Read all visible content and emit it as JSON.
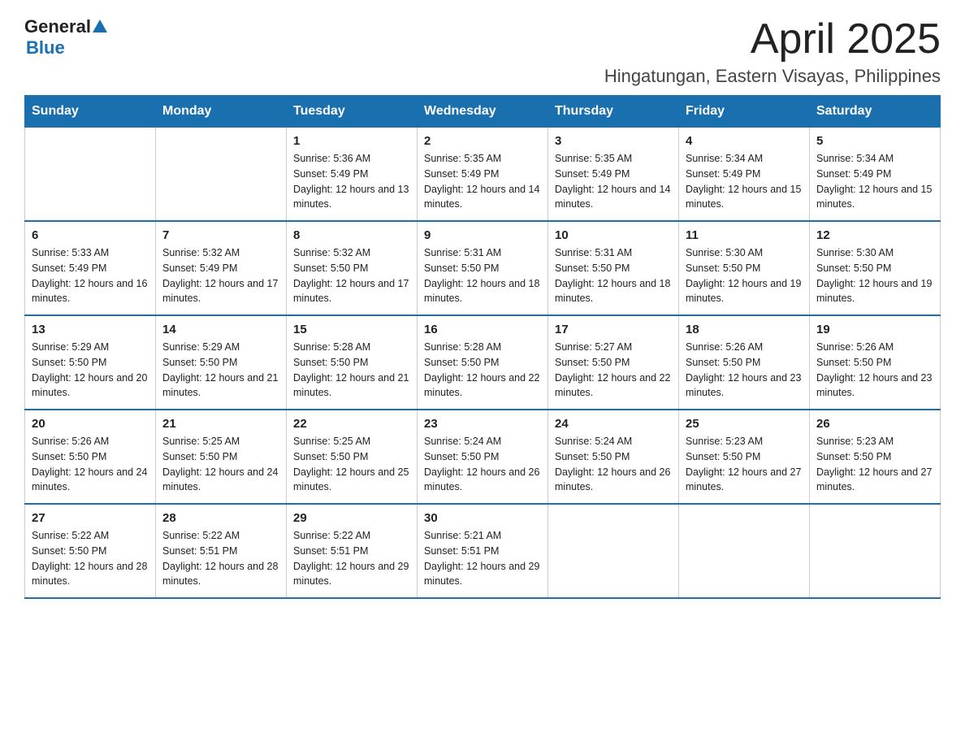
{
  "header": {
    "logo": {
      "general": "General",
      "blue": "Blue"
    },
    "month": "April 2025",
    "location": "Hingatungan, Eastern Visayas, Philippines"
  },
  "days_of_week": [
    "Sunday",
    "Monday",
    "Tuesday",
    "Wednesday",
    "Thursday",
    "Friday",
    "Saturday"
  ],
  "weeks": [
    [
      {
        "day": "",
        "sunrise": "",
        "sunset": "",
        "daylight": ""
      },
      {
        "day": "",
        "sunrise": "",
        "sunset": "",
        "daylight": ""
      },
      {
        "day": "1",
        "sunrise": "Sunrise: 5:36 AM",
        "sunset": "Sunset: 5:49 PM",
        "daylight": "Daylight: 12 hours and 13 minutes."
      },
      {
        "day": "2",
        "sunrise": "Sunrise: 5:35 AM",
        "sunset": "Sunset: 5:49 PM",
        "daylight": "Daylight: 12 hours and 14 minutes."
      },
      {
        "day": "3",
        "sunrise": "Sunrise: 5:35 AM",
        "sunset": "Sunset: 5:49 PM",
        "daylight": "Daylight: 12 hours and 14 minutes."
      },
      {
        "day": "4",
        "sunrise": "Sunrise: 5:34 AM",
        "sunset": "Sunset: 5:49 PM",
        "daylight": "Daylight: 12 hours and 15 minutes."
      },
      {
        "day": "5",
        "sunrise": "Sunrise: 5:34 AM",
        "sunset": "Sunset: 5:49 PM",
        "daylight": "Daylight: 12 hours and 15 minutes."
      }
    ],
    [
      {
        "day": "6",
        "sunrise": "Sunrise: 5:33 AM",
        "sunset": "Sunset: 5:49 PM",
        "daylight": "Daylight: 12 hours and 16 minutes."
      },
      {
        "day": "7",
        "sunrise": "Sunrise: 5:32 AM",
        "sunset": "Sunset: 5:49 PM",
        "daylight": "Daylight: 12 hours and 17 minutes."
      },
      {
        "day": "8",
        "sunrise": "Sunrise: 5:32 AM",
        "sunset": "Sunset: 5:50 PM",
        "daylight": "Daylight: 12 hours and 17 minutes."
      },
      {
        "day": "9",
        "sunrise": "Sunrise: 5:31 AM",
        "sunset": "Sunset: 5:50 PM",
        "daylight": "Daylight: 12 hours and 18 minutes."
      },
      {
        "day": "10",
        "sunrise": "Sunrise: 5:31 AM",
        "sunset": "Sunset: 5:50 PM",
        "daylight": "Daylight: 12 hours and 18 minutes."
      },
      {
        "day": "11",
        "sunrise": "Sunrise: 5:30 AM",
        "sunset": "Sunset: 5:50 PM",
        "daylight": "Daylight: 12 hours and 19 minutes."
      },
      {
        "day": "12",
        "sunrise": "Sunrise: 5:30 AM",
        "sunset": "Sunset: 5:50 PM",
        "daylight": "Daylight: 12 hours and 19 minutes."
      }
    ],
    [
      {
        "day": "13",
        "sunrise": "Sunrise: 5:29 AM",
        "sunset": "Sunset: 5:50 PM",
        "daylight": "Daylight: 12 hours and 20 minutes."
      },
      {
        "day": "14",
        "sunrise": "Sunrise: 5:29 AM",
        "sunset": "Sunset: 5:50 PM",
        "daylight": "Daylight: 12 hours and 21 minutes."
      },
      {
        "day": "15",
        "sunrise": "Sunrise: 5:28 AM",
        "sunset": "Sunset: 5:50 PM",
        "daylight": "Daylight: 12 hours and 21 minutes."
      },
      {
        "day": "16",
        "sunrise": "Sunrise: 5:28 AM",
        "sunset": "Sunset: 5:50 PM",
        "daylight": "Daylight: 12 hours and 22 minutes."
      },
      {
        "day": "17",
        "sunrise": "Sunrise: 5:27 AM",
        "sunset": "Sunset: 5:50 PM",
        "daylight": "Daylight: 12 hours and 22 minutes."
      },
      {
        "day": "18",
        "sunrise": "Sunrise: 5:26 AM",
        "sunset": "Sunset: 5:50 PM",
        "daylight": "Daylight: 12 hours and 23 minutes."
      },
      {
        "day": "19",
        "sunrise": "Sunrise: 5:26 AM",
        "sunset": "Sunset: 5:50 PM",
        "daylight": "Daylight: 12 hours and 23 minutes."
      }
    ],
    [
      {
        "day": "20",
        "sunrise": "Sunrise: 5:26 AM",
        "sunset": "Sunset: 5:50 PM",
        "daylight": "Daylight: 12 hours and 24 minutes."
      },
      {
        "day": "21",
        "sunrise": "Sunrise: 5:25 AM",
        "sunset": "Sunset: 5:50 PM",
        "daylight": "Daylight: 12 hours and 24 minutes."
      },
      {
        "day": "22",
        "sunrise": "Sunrise: 5:25 AM",
        "sunset": "Sunset: 5:50 PM",
        "daylight": "Daylight: 12 hours and 25 minutes."
      },
      {
        "day": "23",
        "sunrise": "Sunrise: 5:24 AM",
        "sunset": "Sunset: 5:50 PM",
        "daylight": "Daylight: 12 hours and 26 minutes."
      },
      {
        "day": "24",
        "sunrise": "Sunrise: 5:24 AM",
        "sunset": "Sunset: 5:50 PM",
        "daylight": "Daylight: 12 hours and 26 minutes."
      },
      {
        "day": "25",
        "sunrise": "Sunrise: 5:23 AM",
        "sunset": "Sunset: 5:50 PM",
        "daylight": "Daylight: 12 hours and 27 minutes."
      },
      {
        "day": "26",
        "sunrise": "Sunrise: 5:23 AM",
        "sunset": "Sunset: 5:50 PM",
        "daylight": "Daylight: 12 hours and 27 minutes."
      }
    ],
    [
      {
        "day": "27",
        "sunrise": "Sunrise: 5:22 AM",
        "sunset": "Sunset: 5:50 PM",
        "daylight": "Daylight: 12 hours and 28 minutes."
      },
      {
        "day": "28",
        "sunrise": "Sunrise: 5:22 AM",
        "sunset": "Sunset: 5:51 PM",
        "daylight": "Daylight: 12 hours and 28 minutes."
      },
      {
        "day": "29",
        "sunrise": "Sunrise: 5:22 AM",
        "sunset": "Sunset: 5:51 PM",
        "daylight": "Daylight: 12 hours and 29 minutes."
      },
      {
        "day": "30",
        "sunrise": "Sunrise: 5:21 AM",
        "sunset": "Sunset: 5:51 PM",
        "daylight": "Daylight: 12 hours and 29 minutes."
      },
      {
        "day": "",
        "sunrise": "",
        "sunset": "",
        "daylight": ""
      },
      {
        "day": "",
        "sunrise": "",
        "sunset": "",
        "daylight": ""
      },
      {
        "day": "",
        "sunrise": "",
        "sunset": "",
        "daylight": ""
      }
    ]
  ]
}
